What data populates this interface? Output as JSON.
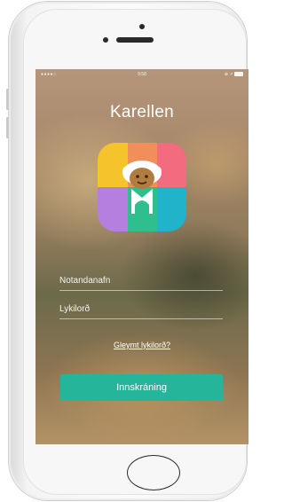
{
  "status_bar": {
    "signal": "●●●●○",
    "time": "9:58",
    "right_icons": "⊕ ↗"
  },
  "app": {
    "title": "Karellen",
    "icon_colors": [
      "#f5c32b",
      "#f08f5b",
      "#f36b7e",
      "#b57fe0",
      "#2fbf8f",
      "#21b3c9"
    ],
    "accent": "#24b59a"
  },
  "login": {
    "username_placeholder": "Notandanafn",
    "password_placeholder": "Lykilorð",
    "forgot_label": "Gleymt lykilorð?",
    "submit_label": "Innskráning"
  }
}
